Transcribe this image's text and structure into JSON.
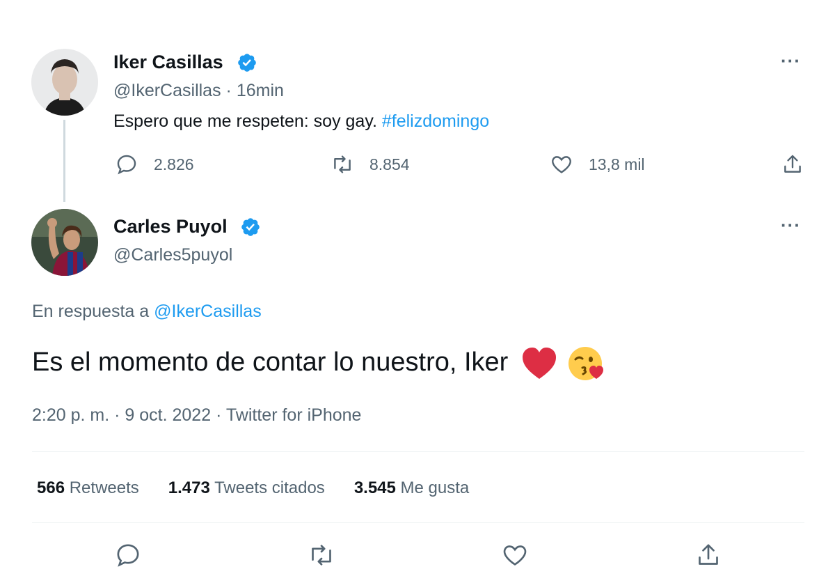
{
  "tweet1": {
    "name": "Iker Casillas",
    "handle": "@IkerCasillas",
    "separator": "·",
    "time": "16min",
    "text": "Espero que me respeten: soy gay.",
    "hashtag": "#felizdomingo",
    "replies": "2.826",
    "retweets": "8.854",
    "likes": "13,8 mil",
    "more_icon": "more-icon"
  },
  "tweet2": {
    "name": "Carles Puyol",
    "handle": "@Carles5puyol",
    "reply_prefix": "En respuesta a",
    "reply_to": "@IkerCasillas",
    "text": "Es el momento de contar lo nuestro, Iker",
    "emojis": [
      "red-heart-emoji",
      "kissing-face-emoji"
    ],
    "meta_time": "2:20 p. m.",
    "meta_date": "9 oct. 2022",
    "meta_source": "Twitter for iPhone",
    "meta_separator": "·"
  },
  "stats": {
    "retweets_count": "566",
    "retweets_label": "Retweets",
    "quotes_count": "1.473",
    "quotes_label": "Tweets citados",
    "likes_count": "3.545",
    "likes_label": "Me gusta"
  },
  "colors": {
    "accent": "#1d9bf0",
    "text": "#0f1419",
    "muted": "#536471",
    "divider": "#eff3f4",
    "thread_line": "#cfd9de",
    "verified": "#1d9bf0",
    "heart": "#e0245e"
  }
}
